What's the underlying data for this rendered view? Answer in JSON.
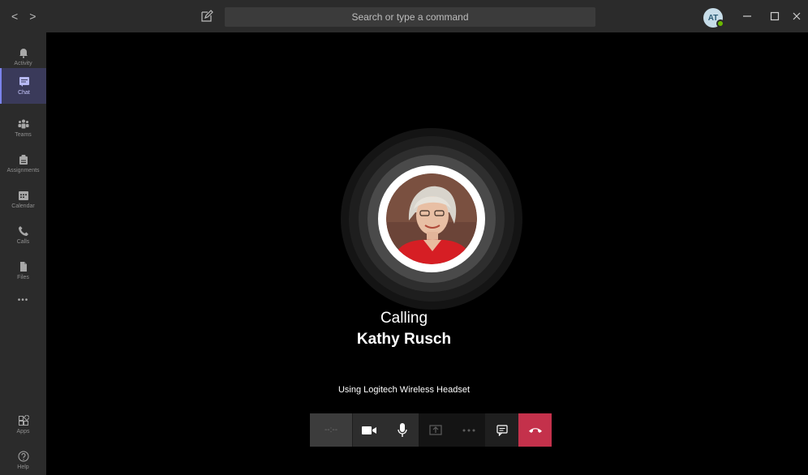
{
  "titlebar": {
    "back_glyph": "<",
    "forward_glyph": ">",
    "search_placeholder": "Search or type a command",
    "avatar_initials": "AT"
  },
  "rail": {
    "items": [
      {
        "label": "Activity",
        "icon": "bell-icon"
      },
      {
        "label": "Chat",
        "icon": "chat-icon",
        "active": true
      },
      {
        "label": "Teams",
        "icon": "teams-icon"
      },
      {
        "label": "Assignments",
        "icon": "assignments-icon"
      },
      {
        "label": "Calendar",
        "icon": "calendar-icon"
      },
      {
        "label": "Calls",
        "icon": "phone-icon"
      },
      {
        "label": "Files",
        "icon": "file-icon"
      }
    ],
    "more_label": "•••",
    "apps_label": "Apps",
    "help_label": "Help"
  },
  "call": {
    "status": "Calling",
    "callee": "Kathy Rusch",
    "device": "Using Logitech Wireless Headset",
    "timer": "--:--"
  },
  "colors": {
    "accent": "#7b83eb",
    "hangup": "#c4314b",
    "presence": "#6bb700"
  }
}
